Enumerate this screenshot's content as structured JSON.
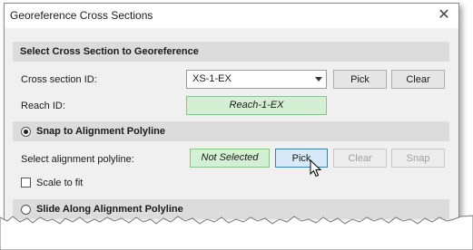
{
  "window": {
    "title": "Georeference Cross Sections"
  },
  "section_select": {
    "title": "Select Cross Section to Georeference",
    "cross_section_label": "Cross section ID:",
    "cross_section_value": "XS-1-EX",
    "pick_label": "Pick",
    "clear_label": "Clear",
    "reach_label": "Reach ID:",
    "reach_value": "Reach-1-EX"
  },
  "section_snap": {
    "title": "Snap to Alignment Polyline",
    "selected": true,
    "polyline_label": "Select alignment polyline:",
    "polyline_value": "Not Selected",
    "pick_label": "Pick",
    "clear_label": "Clear",
    "snap_label": "Snap",
    "scale_label": "Scale to fit",
    "scale_checked": false
  },
  "section_slide": {
    "title": "Slide Along Alignment Polyline",
    "selected": false
  },
  "colors": {
    "green_field": "#d4f0d4",
    "hot_button": "#d8eaf9",
    "section_header": "#dcdcdc"
  }
}
